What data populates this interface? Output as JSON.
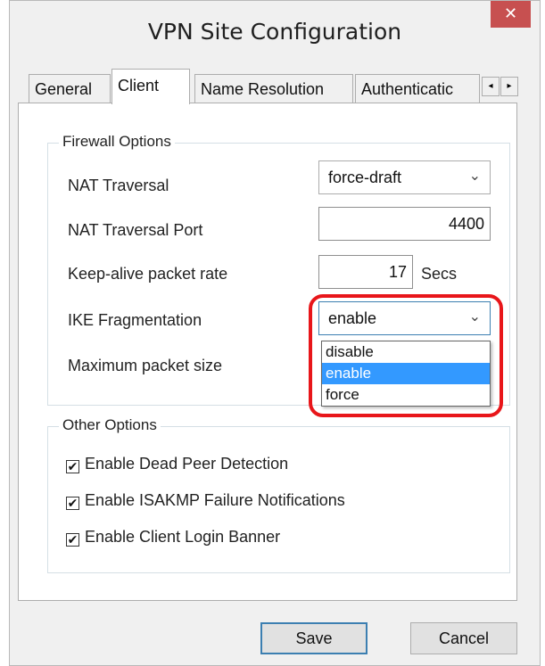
{
  "window": {
    "title": "VPN Site Configuration",
    "close_glyph": "✕"
  },
  "tabs": [
    {
      "label": "General",
      "active": false
    },
    {
      "label": "Client",
      "active": true
    },
    {
      "label": "Name Resolution",
      "active": false
    },
    {
      "label": "Authenticatic",
      "active": false
    }
  ],
  "tab_scroll": {
    "left": "◂",
    "right": "▸"
  },
  "firewall": {
    "legend": "Firewall Options",
    "nat_traversal": {
      "label": "NAT Traversal",
      "value": "force-draft"
    },
    "nat_port": {
      "label": "NAT Traversal Port",
      "value": "4400"
    },
    "keepalive": {
      "label": "Keep-alive packet rate",
      "value": "17",
      "unit": "Secs"
    },
    "ike_frag": {
      "label": "IKE Fragmentation",
      "value": "enable",
      "options": [
        "disable",
        "enable",
        "force"
      ],
      "selected_index": 1
    },
    "max_packet": {
      "label": "Maximum packet size"
    }
  },
  "other": {
    "legend": "Other Options",
    "checkboxes": [
      {
        "label": "Enable Dead Peer Detection",
        "checked": true
      },
      {
        "label": "Enable ISAKMP Failure Notifications",
        "checked": true
      },
      {
        "label": "Enable Client Login Banner",
        "checked": true
      }
    ]
  },
  "buttons": {
    "save": "Save",
    "cancel": "Cancel"
  },
  "check_glyph": "✔",
  "chevron_glyph": "⌄",
  "colors": {
    "highlight": "#e8161a",
    "selection": "#3399ff",
    "close": "#c75050"
  }
}
